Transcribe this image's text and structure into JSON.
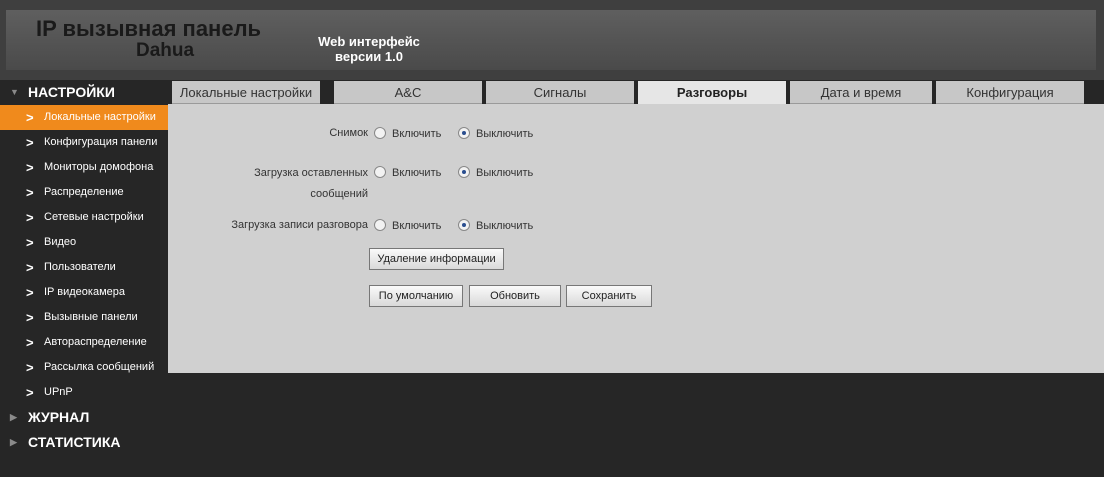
{
  "header": {
    "brand_line1": "IP вызывная панель",
    "brand_line2": "Dahua",
    "web_line1": "Web интерфейс",
    "web_line2": "версии 1.0"
  },
  "sidebar": {
    "settings_label": "НАСТРОЙКИ",
    "items": [
      {
        "label": "Локальные настройки",
        "active": true
      },
      {
        "label": "Конфигурация панели"
      },
      {
        "label": "Мониторы домофона"
      },
      {
        "label": "Распределение"
      },
      {
        "label": "Сетевые настройки"
      },
      {
        "label": "Видео"
      },
      {
        "label": "Пользователи"
      },
      {
        "label": "IP видеокамера"
      },
      {
        "label": "Вызывные панели"
      },
      {
        "label": "Авторaспределение"
      },
      {
        "label": "Рассылка сообщений"
      },
      {
        "label": "UPnP"
      }
    ],
    "log_label": "ЖУРНАЛ",
    "stats_label": "СТАТИСТИКА"
  },
  "tabs": [
    {
      "label": "Локальные настройки"
    },
    {
      "label": "A&C"
    },
    {
      "label": "Сигналы"
    },
    {
      "label": "Разговоры",
      "active": true
    },
    {
      "label": "Дата и время"
    },
    {
      "label": "Конфигурация"
    }
  ],
  "form": {
    "snapshot_label": "Снимок",
    "messages_label_1": "Загрузка оставленных",
    "messages_label_2": "сообщений",
    "record_label": "Загрузка записи разговора",
    "enable_label": "Включить",
    "disable_label": "Выключить",
    "snapshot_value": "Выключить",
    "messages_value": "Выключить",
    "record_value": "Выключить"
  },
  "buttons": {
    "delete_info": "Удаление информации",
    "default": "По умолчанию",
    "refresh": "Обновить",
    "save": "Сохранить"
  }
}
